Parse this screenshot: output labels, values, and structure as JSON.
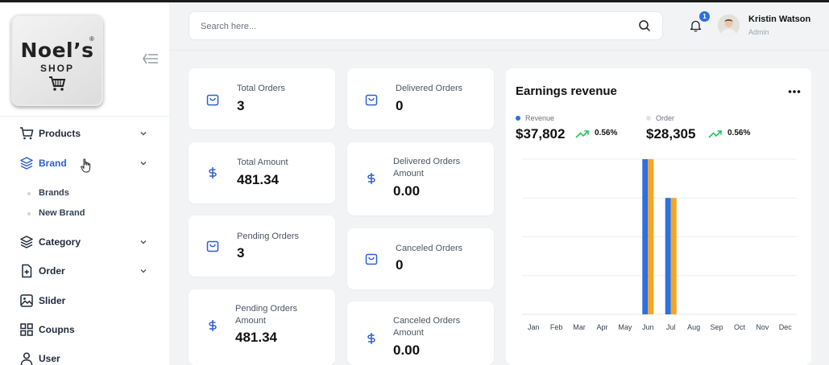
{
  "brand": {
    "name": "Noel’s",
    "sub": "SHOP",
    "reg": "®"
  },
  "sidebar": {
    "items": [
      {
        "label": "Products",
        "icon": "cart-icon",
        "expandable": true
      },
      {
        "label": "Brand",
        "icon": "layers-icon",
        "expandable": true,
        "active": true,
        "sub": [
          "Brands",
          "New Brand"
        ]
      },
      {
        "label": "Category",
        "icon": "layers-icon",
        "expandable": true
      },
      {
        "label": "Order",
        "icon": "file-plus-icon",
        "expandable": true
      },
      {
        "label": "Slider",
        "icon": "image-icon",
        "expandable": false
      },
      {
        "label": "Coupns",
        "icon": "grid-icon",
        "expandable": false
      },
      {
        "label": "User",
        "icon": "user-icon",
        "expandable": false
      }
    ],
    "active_color": "#2d5fd3"
  },
  "header": {
    "search_placeholder": "Search here...",
    "notification_count": "1",
    "user_name": "Kristin Watson",
    "user_role": "Admin"
  },
  "stats": {
    "left": [
      {
        "label": "Total Orders",
        "value": "3",
        "icon": "bag-icon"
      },
      {
        "label": "Total Amount",
        "value": "481.34",
        "icon": "dollar-icon"
      },
      {
        "label": "Pending Orders",
        "value": "3",
        "icon": "bag-icon"
      },
      {
        "label": "Pending Orders Amount",
        "value": "481.34",
        "icon": "dollar-icon"
      }
    ],
    "right": [
      {
        "label": "Delivered Orders",
        "value": "0",
        "icon": "bag-icon"
      },
      {
        "label": "Delivered Orders Amount",
        "value": "0.00",
        "icon": "dollar-icon"
      },
      {
        "label": "Canceled Orders",
        "value": "0",
        "icon": "bag-icon"
      },
      {
        "label": "Canceled Orders Amount",
        "value": "0.00",
        "icon": "dollar-icon"
      }
    ]
  },
  "earnings": {
    "title": "Earnings revenue",
    "revenue": {
      "name": "Revenue",
      "value": "$37,802",
      "change": "0.56%",
      "color": "#2f6fdf"
    },
    "order": {
      "name": "Order",
      "value": "$28,305",
      "change": "0.56%",
      "color": "#dbe4f3"
    }
  },
  "chart_data": {
    "type": "bar",
    "categories": [
      "Jan",
      "Feb",
      "Mar",
      "Apr",
      "May",
      "Jun",
      "Jul",
      "Aug",
      "Sep",
      "Oct",
      "Nov",
      "Dec"
    ],
    "series": [
      {
        "name": "Revenue",
        "color": "#2f6fdf",
        "values": [
          0,
          0,
          0,
          0,
          0,
          100,
          75,
          0,
          0,
          0,
          0,
          0
        ]
      },
      {
        "name": "Order",
        "color": "#f5a623",
        "values": [
          0,
          0,
          0,
          0,
          0,
          100,
          75,
          0,
          0,
          0,
          0,
          0
        ]
      }
    ],
    "ylim": [
      0,
      100
    ],
    "grid": true,
    "legend": "top-left"
  }
}
